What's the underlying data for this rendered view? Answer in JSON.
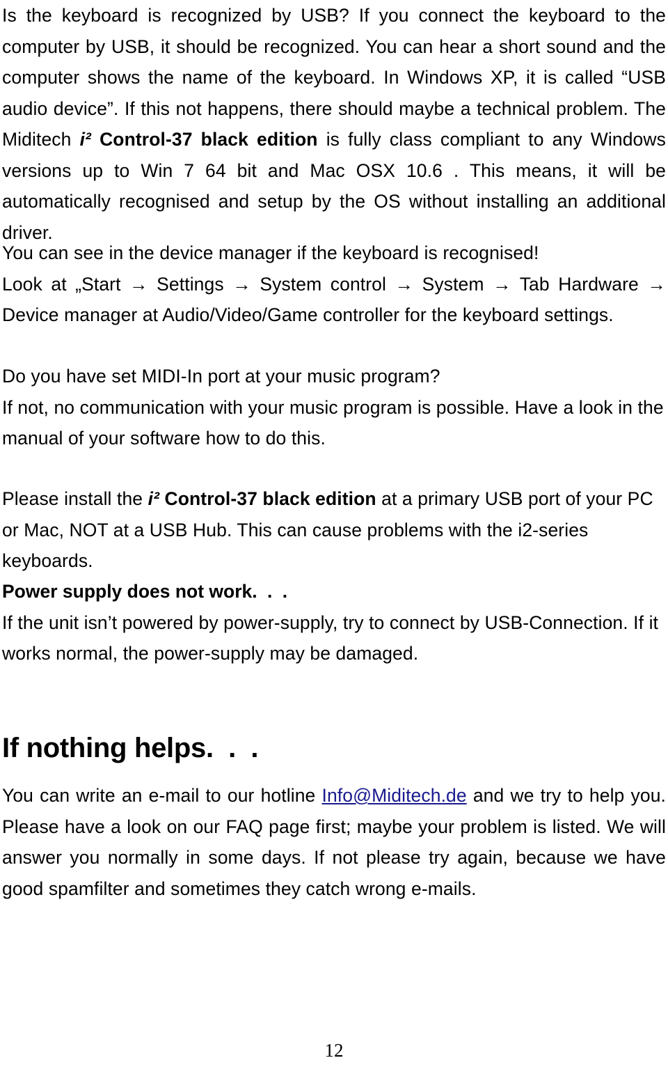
{
  "document": {
    "page_number": "12",
    "link_color": "#1a1a8e",
    "text_color": "#000000",
    "background_color": "#ffffff"
  },
  "paragraphs": {
    "usb_recognition": {
      "part1": "Is the keyboard is recognized by USB?  If you connect the keyboard to the computer by USB, it should be recognized. You can hear a short sound and the computer shows the name of the keyboard. In Windows XP, it is called “USB audio device”. If this not happens, there should maybe a technical problem. The Miditech ",
      "product_italic": "i²",
      "product_bold": " Control-37 black edition",
      "part2": " is fully class compliant to any Windows versions up to Win 7 64 bit and Mac OSX 10.6 . This means, it will be automatically recognised and setup by the OS without installing an additional driver."
    },
    "device_manager": {
      "line1": "You can see in the device manager if the keyboard is recognised!",
      "line2": "Look at „Start → Settings → System control → System → Tab Hardware → Device manager at Audio/Video/Game controller for the keyboard settings."
    },
    "midi_in": {
      "line1": "Do you have set MIDI-In port at your music program?",
      "line2": "If not, no communication with your music program is possible. Have a look in the manual of your software how to do this."
    },
    "usb_port": {
      "part1": "Please install the ",
      "product_italic": "i²",
      "product_bold": " Control-37 black edition",
      "part2": " at a primary USB port of your PC or Mac, NOT at a USB Hub. This can cause problems with the i2-series keyboards."
    },
    "power_supply": {
      "heading": "Power supply does not work",
      "heading_dots": ". . .",
      "body": "If the unit isn’t powered by power-supply, try to connect by USB-Connection. If it works normal, the power-supply may be damaged."
    },
    "nothing_helps": {
      "heading": "If nothing helps",
      "heading_dots": ". . .",
      "body_before_link": "You can write an e-mail to our hotline ",
      "email_link": "Info@Miditech.de",
      "body_after_link": " and we try to help you. Please have a look on our FAQ page first; maybe your problem is listed. We will answer you normally in some days. If not please try again, because we have good spamfilter and sometimes they catch wrong e-mails."
    }
  }
}
